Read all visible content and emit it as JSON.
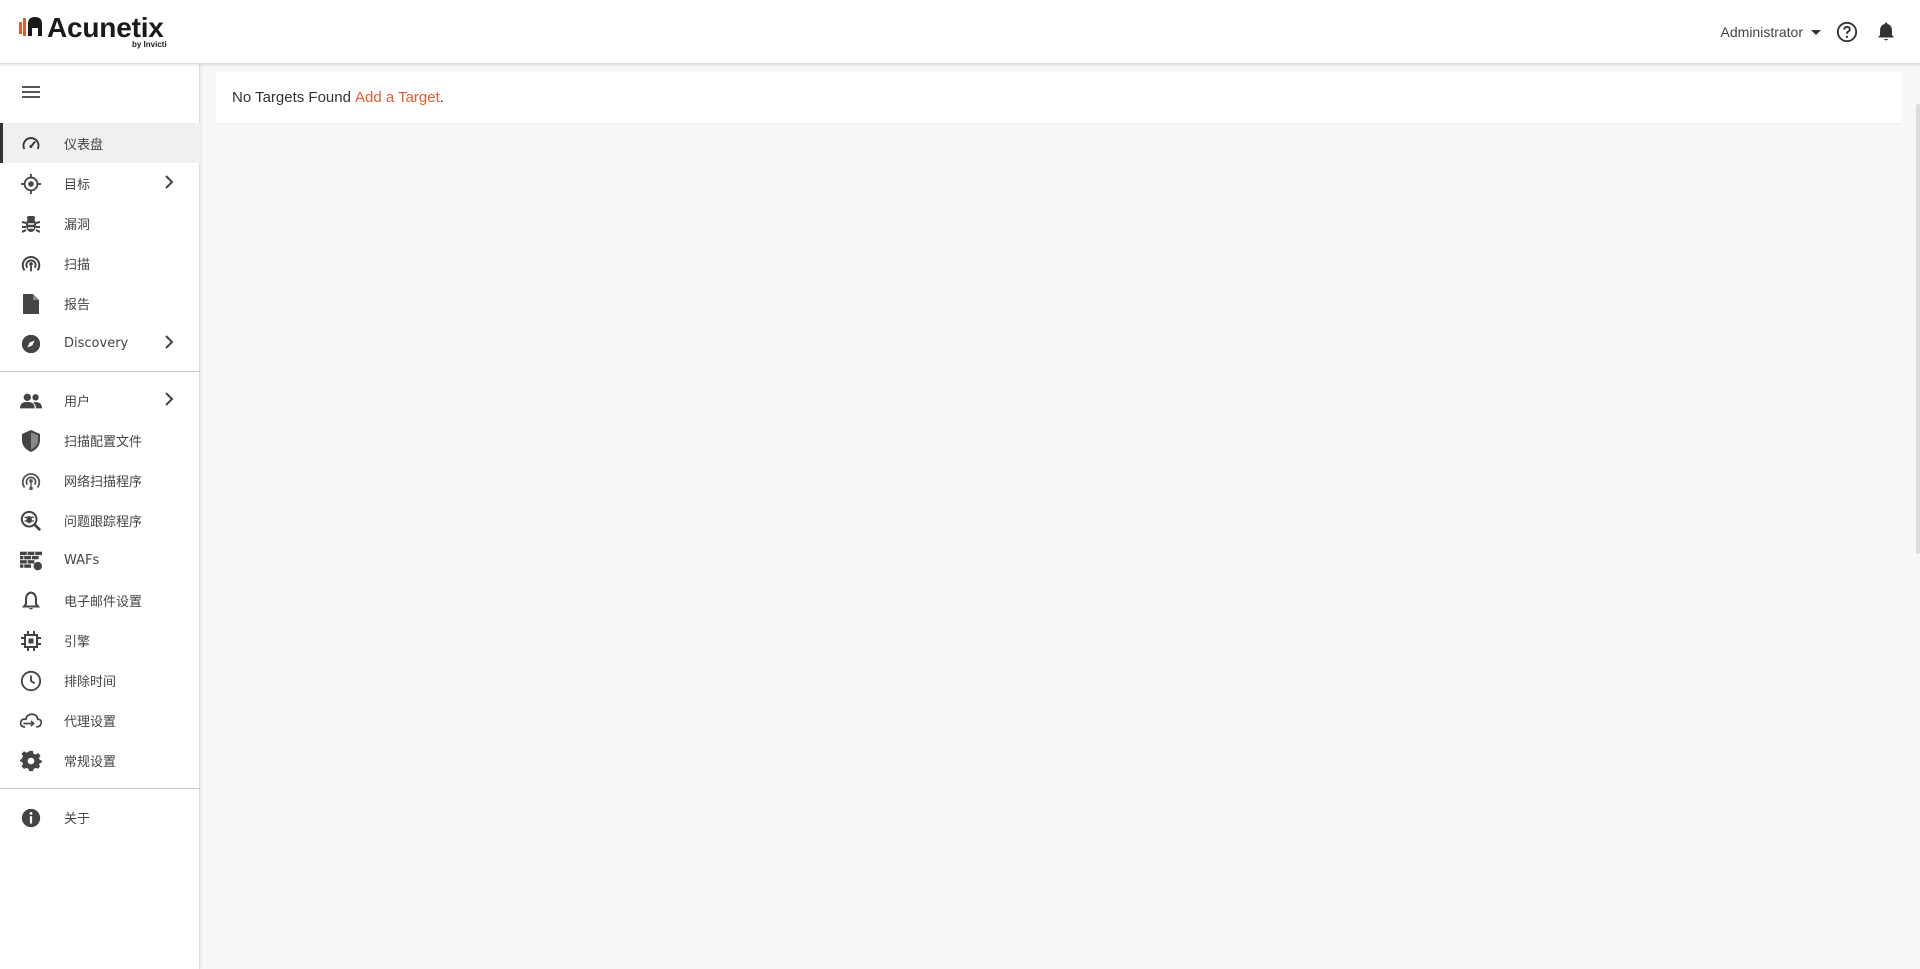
{
  "brand": {
    "name": "Acunetix",
    "sub": "by Invicti",
    "colors": {
      "accent": "#e85a30",
      "dark": "#1a1a1a"
    }
  },
  "header": {
    "user_label": "Administrator",
    "help_icon": "help-circle-icon",
    "notifications_icon": "bell-icon"
  },
  "sidebar": {
    "toggle_icon": "hamburger-icon",
    "groups": [
      [
        {
          "label": "仪表盘",
          "icon": "dashboard-gauge-icon",
          "active": true
        },
        {
          "label": "目标",
          "icon": "target-icon",
          "chevron": true
        },
        {
          "label": "漏洞",
          "icon": "bug-icon"
        },
        {
          "label": "扫描",
          "icon": "radar-icon"
        },
        {
          "label": "报告",
          "icon": "document-icon"
        },
        {
          "label": "Discovery",
          "icon": "compass-icon",
          "chevron": true
        }
      ],
      [
        {
          "label": "用户",
          "icon": "users-icon",
          "chevron": true
        },
        {
          "label": "扫描配置文件",
          "icon": "shield-icon"
        },
        {
          "label": "网络扫描程序",
          "icon": "network-scanner-icon"
        },
        {
          "label": "问题跟踪程序",
          "icon": "issue-tracker-icon"
        },
        {
          "label": "WAFs",
          "icon": "firewall-icon"
        },
        {
          "label": "电子邮件设置",
          "icon": "bell-outline-icon"
        },
        {
          "label": "引擎",
          "icon": "chip-icon"
        },
        {
          "label": "排除时间",
          "icon": "clock-icon"
        },
        {
          "label": "代理设置",
          "icon": "cloud-proxy-icon"
        },
        {
          "label": "常规设置",
          "icon": "gear-icon"
        }
      ],
      [
        {
          "label": "关于",
          "icon": "info-icon"
        }
      ]
    ]
  },
  "main": {
    "notice_text": "No Targets Found",
    "notice_link": "Add a Target",
    "notice_suffix": "."
  }
}
